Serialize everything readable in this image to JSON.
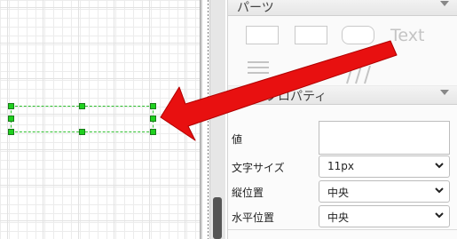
{
  "parts_section": {
    "title": "パーツ",
    "text_shape_label": "Text"
  },
  "properties_section": {
    "title": "プロパティ",
    "value_label": "値",
    "value_input": "",
    "font_size": {
      "label": "文字サイズ",
      "selected": "11px"
    },
    "vertical_align": {
      "label": "縦位置",
      "selected": "中央"
    },
    "horizontal_align": {
      "label": "水平位置",
      "selected": "中央"
    }
  },
  "colors": {
    "selection": "#2ec02e",
    "handle": "#1fd11f",
    "arrow": "#e81010"
  },
  "icons": [
    "collapse-arrow-icon",
    "chevron-down-icon",
    "red-pointer-arrow"
  ]
}
